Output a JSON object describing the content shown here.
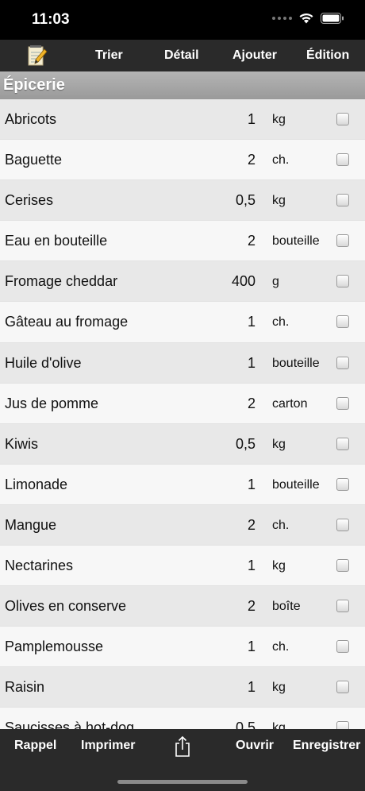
{
  "status_bar": {
    "time": "11:03"
  },
  "toolbar": {
    "notes_icon": "notepad-pencil-icon",
    "sort_label": "Trier",
    "detail_label": "Détail",
    "add_label": "Ajouter",
    "edit_label": "Édition"
  },
  "section": {
    "title": "Épicerie"
  },
  "items": [
    {
      "name": "Abricots",
      "qty": "1",
      "unit": "kg"
    },
    {
      "name": "Baguette",
      "qty": "2",
      "unit": "ch."
    },
    {
      "name": "Cerises",
      "qty": "0,5",
      "unit": "kg"
    },
    {
      "name": "Eau en bouteille",
      "qty": "2",
      "unit": "bouteille"
    },
    {
      "name": "Fromage cheddar",
      "qty": "400",
      "unit": "g"
    },
    {
      "name": "Gâteau au fromage",
      "qty": "1",
      "unit": "ch."
    },
    {
      "name": "Huile d'olive",
      "qty": "1",
      "unit": "bouteille"
    },
    {
      "name": "Jus de pomme",
      "qty": "2",
      "unit": "carton"
    },
    {
      "name": "Kiwis",
      "qty": "0,5",
      "unit": "kg"
    },
    {
      "name": "Limonade",
      "qty": "1",
      "unit": "bouteille"
    },
    {
      "name": "Mangue",
      "qty": "2",
      "unit": "ch."
    },
    {
      "name": "Nectarines",
      "qty": "1",
      "unit": "kg"
    },
    {
      "name": "Olives en conserve",
      "qty": "2",
      "unit": "boîte"
    },
    {
      "name": "Pamplemousse",
      "qty": "1",
      "unit": "ch."
    },
    {
      "name": "Raisin",
      "qty": "1",
      "unit": "kg"
    },
    {
      "name": "Saucisses à hot-dog",
      "qty": "0,5",
      "unit": "kg"
    }
  ],
  "bottom_bar": {
    "reminder_label": "Rappel",
    "print_label": "Imprimer",
    "share_icon": "share-icon",
    "open_label": "Ouvrir",
    "save_label": "Enregistrer"
  }
}
